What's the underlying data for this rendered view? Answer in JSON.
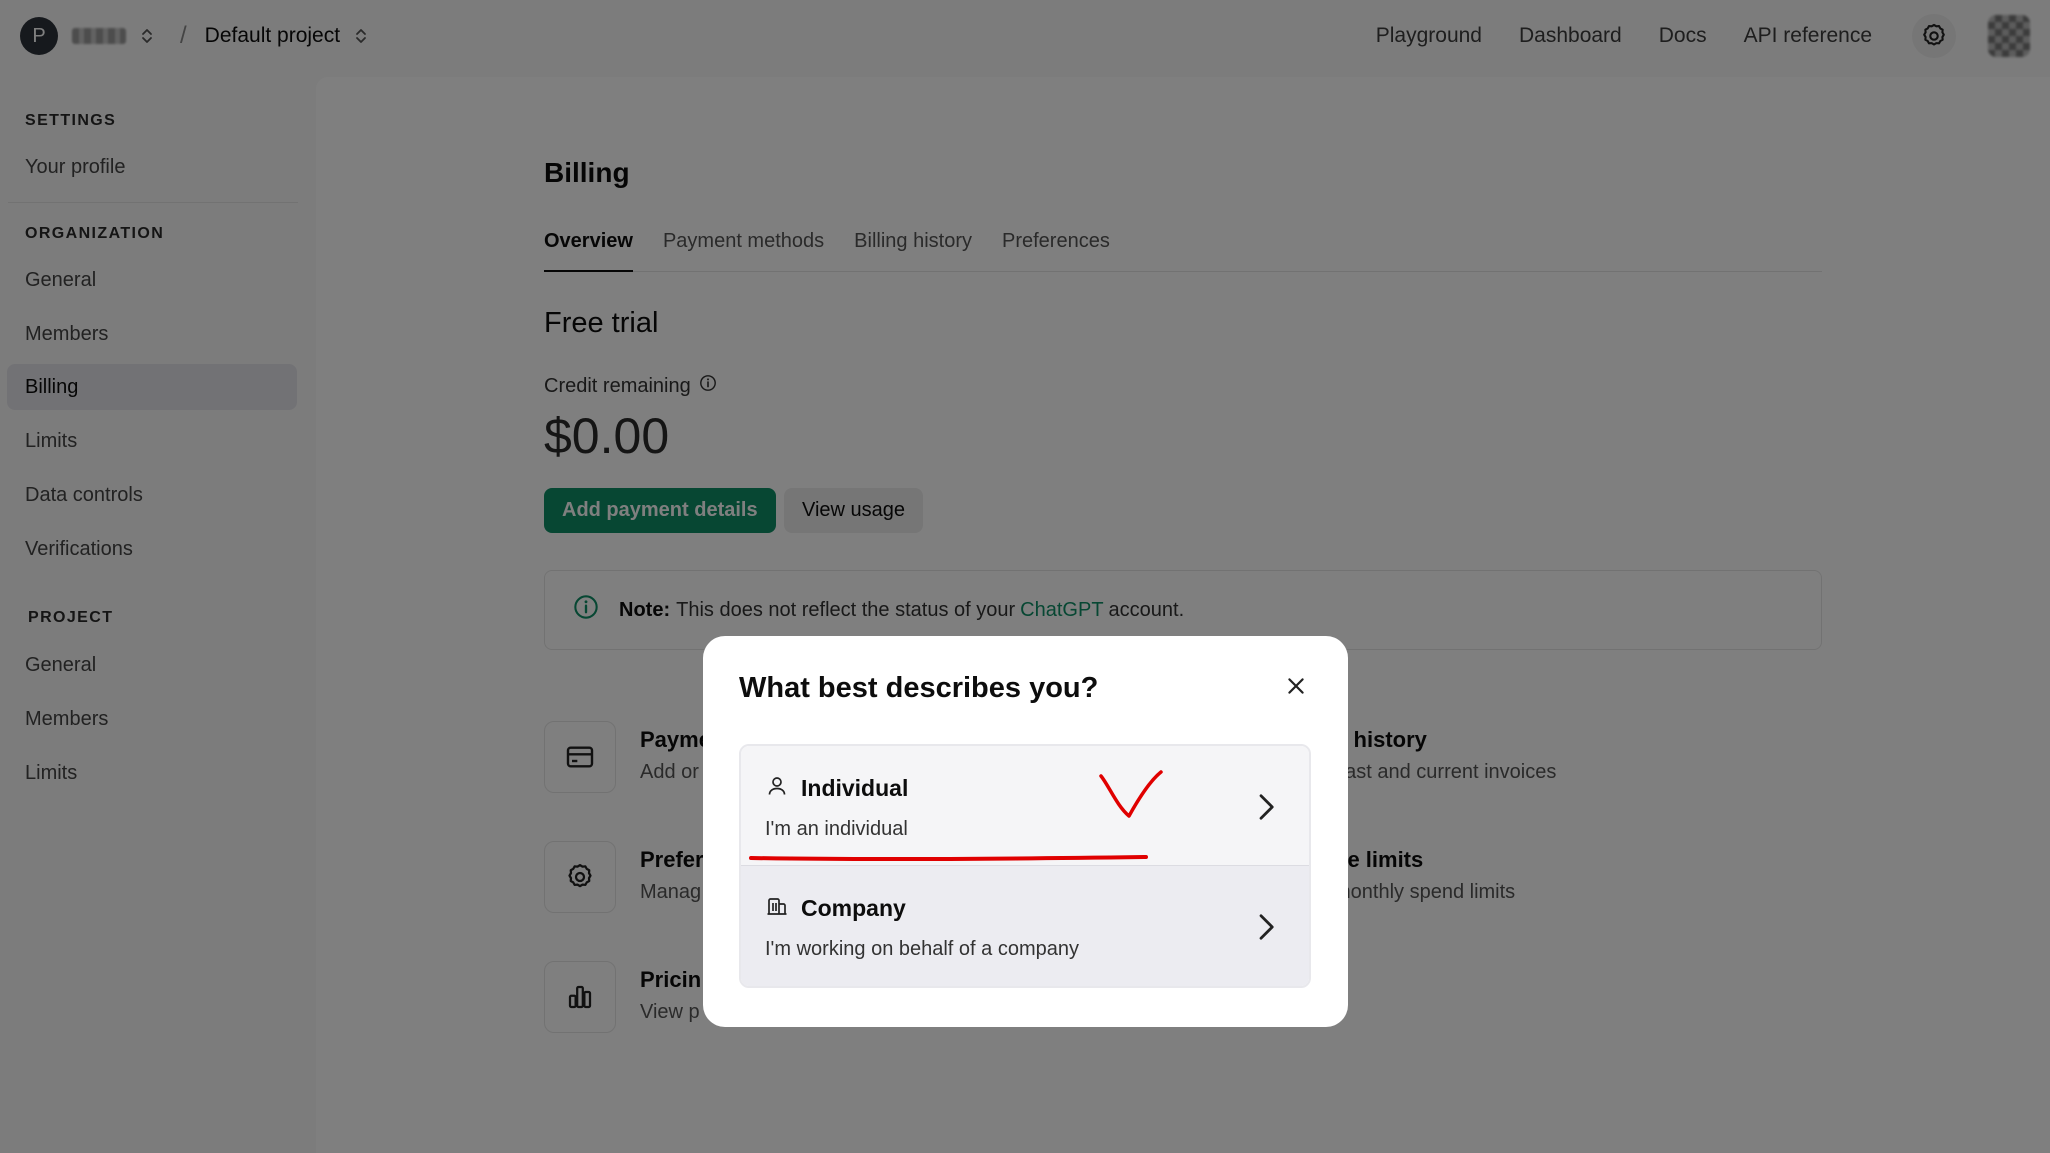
{
  "topbar": {
    "org_initial": "P",
    "project_name": "Default project",
    "nav": [
      "Playground",
      "Dashboard",
      "Docs",
      "API reference"
    ]
  },
  "sidebar": {
    "settings_title": "SETTINGS",
    "your_profile": "Your profile",
    "organization_title": "ORGANIZATION",
    "org_items": [
      "General",
      "Members",
      "Billing",
      "Limits",
      "Data controls",
      "Verifications"
    ],
    "project_title": "PROJECT",
    "project_items": [
      "General",
      "Members",
      "Limits"
    ]
  },
  "billing": {
    "title": "Billing",
    "tabs": [
      "Overview",
      "Payment methods",
      "Billing history",
      "Preferences"
    ],
    "section_title": "Free trial",
    "credit_label": "Credit remaining",
    "credit_value": "$0.00",
    "add_payment": "Add payment details",
    "view_usage": "View usage",
    "note_label": "Note:",
    "note_text_before": "This does not reflect the status of your",
    "note_link": "ChatGPT",
    "note_text_after": "account.",
    "features_left": [
      {
        "title": "Payme",
        "desc": "Add or"
      },
      {
        "title": "Prefer",
        "desc": "Manag"
      },
      {
        "title": "Pricin",
        "desc": "View p"
      }
    ],
    "features_right": [
      {
        "title": "g history",
        "desc": "past and current invoices"
      },
      {
        "title": "ge limits",
        "desc": "monthly spend limits"
      }
    ]
  },
  "modal": {
    "title": "What best describes you?",
    "options": [
      {
        "title": "Individual",
        "desc": "I'm an individual"
      },
      {
        "title": "Company",
        "desc": "I'm working on behalf of a company"
      }
    ]
  },
  "colors": {
    "accent_green": "#0f8f66",
    "annotation_red": "#e00000"
  }
}
